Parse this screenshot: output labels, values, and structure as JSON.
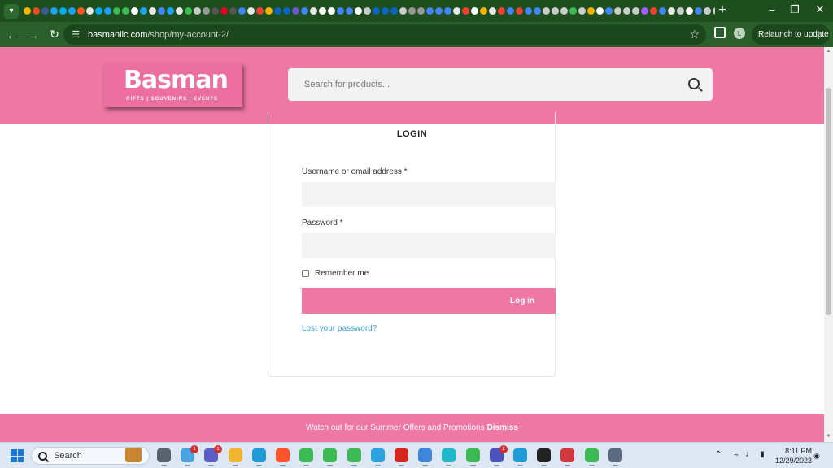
{
  "browser": {
    "url_host": "basmanllc.com",
    "url_path": "/shop/my-account-2/",
    "relaunch_label": "Relaunch to update",
    "profile_initial": "L",
    "favicon_colors": [
      "#f5b400",
      "#e44d26",
      "#3b5998",
      "#1da1f2",
      "#00acee",
      "#1da1f2",
      "#ff5722",
      "#e8e8e8",
      "#00acee",
      "#1da1f2",
      "#3cba54",
      "#3cba54",
      "#ffffff",
      "#1da1f2",
      "#e8e8e8",
      "#4285f4",
      "#1da1f2",
      "#e8e8e8",
      "#3cba54",
      "#cccccc",
      "#999999",
      "#555555",
      "#e60023",
      "#555555",
      "#4285f4",
      "#e8e8e8",
      "#ea4335",
      "#f5b400",
      "#0a66c2",
      "#0a66c2",
      "#6a5acd",
      "#4285f4",
      "#e8e8e8",
      "#ffffff",
      "#ffffff",
      "#4285f4",
      "#4285f4",
      "#ffffff",
      "#cccccc",
      "#0a66c2",
      "#0a66c2",
      "#0a66c2",
      "#cccccc",
      "#999999",
      "#999999",
      "#4285f4",
      "#4285f4",
      "#4285f4",
      "#e8e8e8",
      "#ea4335",
      "#ffffff",
      "#f5b400",
      "#e8e8e8",
      "#ea4335",
      "#4285f4",
      "#ea4335",
      "#4285f4",
      "#4285f4",
      "#cccccc",
      "#cccccc",
      "#cccccc",
      "#3cba54",
      "#cccccc",
      "#f5b400",
      "#ffffff",
      "#4285f4",
      "#cccccc",
      "#cccccc",
      "#cccccc",
      "#a259ff",
      "#ea4335",
      "#4285f4",
      "#e8e8e8",
      "#cccccc",
      "#ffffff",
      "#4285f4",
      "#cccccc",
      "#cccccc",
      "#ffffff",
      "#cccccc"
    ]
  },
  "site": {
    "logo_text": "Basman",
    "logo_sub": "GIFTS | SOUVENIRS | EVENTS",
    "search_placeholder": "Search for products..."
  },
  "login": {
    "title": "LOGIN",
    "username_label": "Username or email address *",
    "password_label": "Password *",
    "remember_label": "Remember me",
    "submit_label": "Log in",
    "lost_password": "Lost your password?"
  },
  "notice": {
    "text": "Watch out for our Summer Offers and Promotions",
    "dismiss": "Dismiss"
  },
  "taskbar": {
    "search_label": "Search",
    "time": "8:11 PM",
    "date": "12/29/2023",
    "apps": [
      {
        "name": "task-view",
        "color": "#5a6270",
        "badge": ""
      },
      {
        "name": "cloud",
        "color": "#4aa3df",
        "badge": "1"
      },
      {
        "name": "teams",
        "color": "#5b5fc7",
        "badge": "1"
      },
      {
        "name": "file-explorer",
        "color": "#f2b531",
        "badge": ""
      },
      {
        "name": "edge",
        "color": "#1f9cd6",
        "badge": ""
      },
      {
        "name": "brave",
        "color": "#fb542b",
        "badge": ""
      },
      {
        "name": "chrome-1",
        "color": "#3cba54",
        "badge": ""
      },
      {
        "name": "chrome-2",
        "color": "#3cba54",
        "badge": ""
      },
      {
        "name": "chrome-3",
        "color": "#3cba54",
        "badge": ""
      },
      {
        "name": "telegram",
        "color": "#2aa3df",
        "badge": ""
      },
      {
        "name": "acrobat",
        "color": "#d4261c",
        "badge": ""
      },
      {
        "name": "notepad",
        "color": "#3c87d8",
        "badge": ""
      },
      {
        "name": "canva",
        "color": "#1fb8c9",
        "badge": ""
      },
      {
        "name": "chrome-4",
        "color": "#3cba54",
        "badge": ""
      },
      {
        "name": "teams-2",
        "color": "#4b53bc",
        "badge": "2"
      },
      {
        "name": "edge-2",
        "color": "#1f9cd6",
        "badge": ""
      },
      {
        "name": "github",
        "color": "#222222",
        "badge": ""
      },
      {
        "name": "figma",
        "color": "#d1373c",
        "badge": ""
      },
      {
        "name": "chrome-5",
        "color": "#3cba54",
        "badge": ""
      },
      {
        "name": "calculator",
        "color": "#5c6a80",
        "badge": ""
      }
    ]
  }
}
